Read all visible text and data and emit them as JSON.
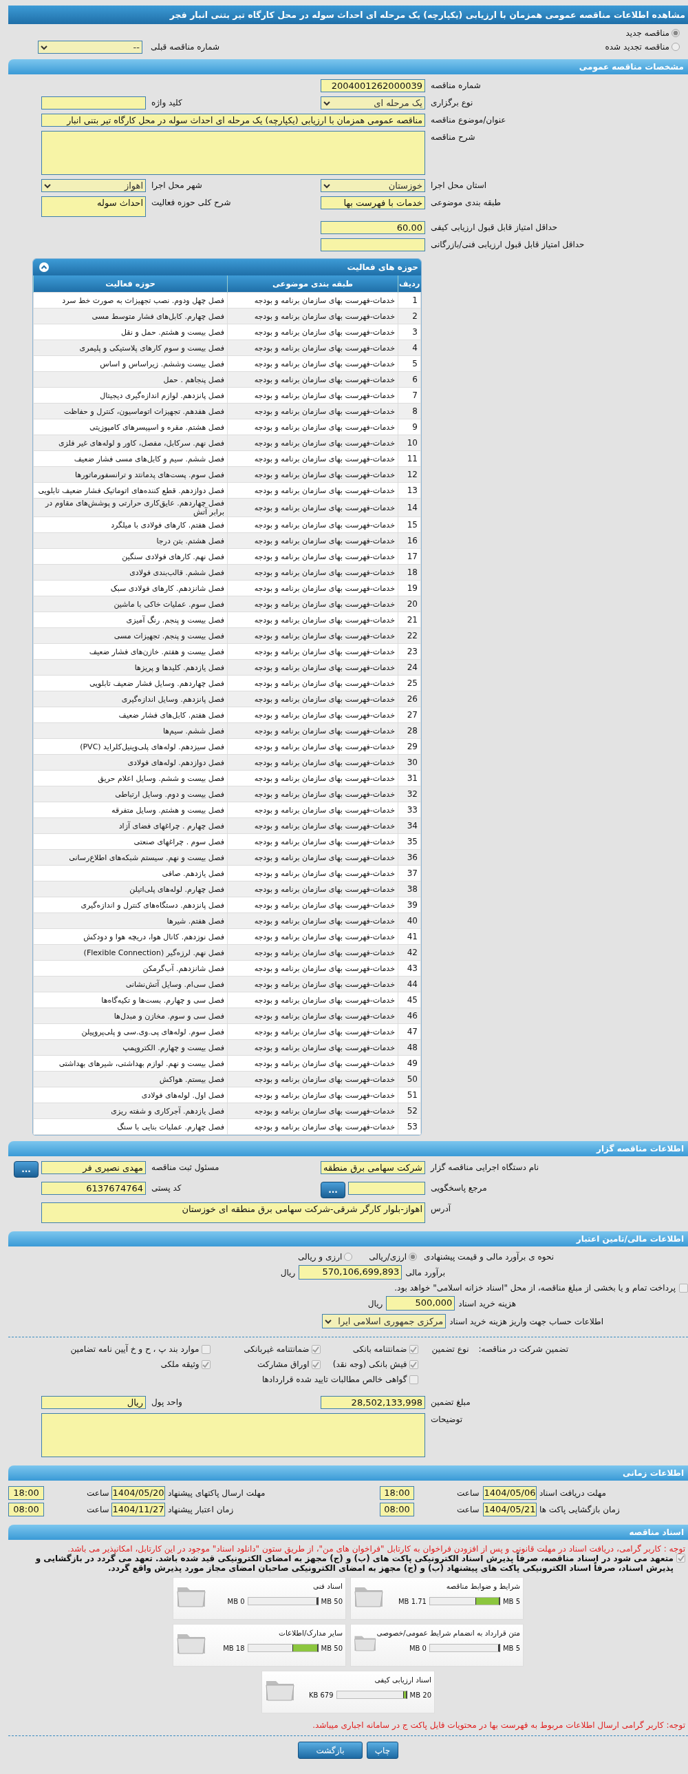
{
  "page_title": "مشاهده اطلاعات مناقصه عمومی همزمان با ارزیابی (یکپارچه) یک مرحله ای احداث سوله در محل کارگاه تیر بتنی انبار فجر",
  "tender_type": [
    {
      "label": "مناقصه جدید",
      "selected": true
    },
    {
      "label": "مناقصه تجدید شده",
      "selected": false
    }
  ],
  "previous_tender": {
    "label": "شماره مناقصه قبلی",
    "value": "--"
  },
  "general": {
    "title": "مشخصات مناقصه عمومی",
    "rows": [
      {
        "fields": [
          {
            "label": "شماره مناقصه",
            "value": "2004001262000039",
            "kind": "text"
          }
        ]
      },
      {
        "fields": [
          {
            "label": "نوع برگزاری",
            "value": "یک مرحله ای",
            "kind": "select"
          },
          {
            "label": "کلید واژه",
            "kind": "text"
          }
        ]
      },
      {
        "fields": [
          {
            "label": "عنوان/موضوع مناقصه",
            "value": "مناقصه عمومی همزمان با ارزیابی (یکپارچه) یک مرحله ای احداث سوله در محل کارگاه تیر بتنی انبار",
            "kind": "long_text"
          }
        ]
      },
      {
        "fields": [
          {
            "label": "شرح مناقصه",
            "kind": "long_textarea"
          }
        ]
      },
      {
        "fields": [
          {
            "label": "استان محل اجرا",
            "value": "خوزستان",
            "kind": "select"
          },
          {
            "label": "شهر محل اجرا",
            "value": "اهواز",
            "kind": "select"
          }
        ]
      },
      {
        "fields": [
          {
            "label": "طبقه بندی موضوعی",
            "value": "خدمات با فهرست بها",
            "kind": "text"
          },
          {
            "label": "شرح کلی حوزه فعالیت",
            "value": "احداث سوله",
            "kind": "textarea"
          }
        ]
      },
      {
        "fields": [
          {
            "label": "حداقل امتیاز قابل قبول ارزیابی کیفی",
            "value": "60.00",
            "kind": "text"
          }
        ]
      },
      {
        "fields": [
          {
            "label": "حداقل امتیاز قابل قبول ارزیابی فنی/بازرگانی",
            "kind": "text"
          }
        ]
      }
    ]
  },
  "activities": {
    "title": "حوزه های فعالیت",
    "columns": [
      "ردیف",
      "طبقه بندی موضوعی",
      "حوزه فعالیت"
    ],
    "rows": [
      [
        "1",
        "خدمات-فهرست بهای سازمان برنامه و بودجه",
        "فصل چهل ودوم. نصب تجهیزات به صورت خط سرد"
      ],
      [
        "2",
        "خدمات-فهرست بهای سازمان برنامه و بودجه",
        "فصل چهارم. کابل‌های فشار متوسط مسی"
      ],
      [
        "3",
        "خدمات-فهرست بهای سازمان برنامه و بودجه",
        "فصل بیست و هشتم. حمل و نقل"
      ],
      [
        "4",
        "خدمات-فهرست بهای سازمان برنامه و بودجه",
        "فصل بیست و سوم کارهای پلاستیکی و پلیمری"
      ],
      [
        "5",
        "خدمات-فهرست بهای سازمان برنامه و بودجه",
        "فصل بیست وششم. زیراساس و اساس"
      ],
      [
        "6",
        "خدمات-فهرست بهای سازمان برنامه و بودجه",
        "فصل پنجاهم . حمل"
      ],
      [
        "7",
        "خدمات-فهرست بهای سازمان برنامه و بودجه",
        "فصل پانزدهم. لوازم اندازه‌گیری دیجیتال"
      ],
      [
        "8",
        "خدمات-فهرست بهای سازمان برنامه و بودجه",
        "فصل هفدهم. تجهیزات اتوماسیون، کنترل و حفاظت"
      ],
      [
        "9",
        "خدمات-فهرست بهای سازمان برنامه و بودجه",
        "فصل هشتم. مقره و اسپیسرهای کامپوزیتی"
      ],
      [
        "10",
        "خدمات-فهرست بهای سازمان برنامه و بودجه",
        "فصل نهم. سرکابل، مفصل، کاور و لوله‌های غیر فلزی"
      ],
      [
        "11",
        "خدمات-فهرست بهای سازمان برنامه و بودجه",
        "فصل ششم. سیم و کابل‌های مسی فشار ضعیف"
      ],
      [
        "12",
        "خدمات-فهرست بهای سازمان برنامه و بودجه",
        "فصل سوم. پست‌های پدمانتد و ترانسفورماتورها"
      ],
      [
        "13",
        "خدمات-فهرست بهای سازمان برنامه و بودجه",
        "فصل دوازدهم. قطع کننده‌های اتوماتیک فشار ضعیف تابلویی"
      ],
      [
        "14",
        "خدمات-فهرست بهای سازمان برنامه و بودجه",
        "فصل چهاردهم. عایق‌کاری حرارتی و پوشش‌های مقاوم در برابر آتش"
      ],
      [
        "15",
        "خدمات-فهرست بهای سازمان برنامه و بودجه",
        "فصل هفتم. کارهای فولادی با میلگرد"
      ],
      [
        "16",
        "خدمات-فهرست بهای سازمان برنامه و بودجه",
        "فصل هشتم. بتن درجا"
      ],
      [
        "17",
        "خدمات-فهرست بهای سازمان برنامه و بودجه",
        "فصل نهم. کارهای فولادی سنگین"
      ],
      [
        "18",
        "خدمات-فهرست بهای سازمان برنامه و بودجه",
        "فصل ششم. قالب‌بندی فولادی"
      ],
      [
        "19",
        "خدمات-فهرست بهای سازمان برنامه و بودجه",
        "فصل شانزدهم. کارهای فولادی سبک"
      ],
      [
        "20",
        "خدمات-فهرست بهای سازمان برنامه و بودجه",
        "فصل سوم. عملیات خاکی با ماشین"
      ],
      [
        "21",
        "خدمات-فهرست بهای سازمان برنامه و بودجه",
        "فصل بیست و پنجم. رنگ آمیزی"
      ],
      [
        "22",
        "خدمات-فهرست بهای سازمان برنامه و بودجه",
        "فصل بیست و پنجم. تجهیزات مسی"
      ],
      [
        "23",
        "خدمات-فهرست بهای سازمان برنامه و بودجه",
        "فصل بیست و هفتم. خازن‌های فشار ضعیف"
      ],
      [
        "24",
        "خدمات-فهرست بهای سازمان برنامه و بودجه",
        "فصل یازدهم. کلیدها و پریزها"
      ],
      [
        "25",
        "خدمات-فهرست بهای سازمان برنامه و بودجه",
        "فصل چهاردهم. وسایل فشار ضعیف تابلویی"
      ],
      [
        "26",
        "خدمات-فهرست بهای سازمان برنامه و بودجه",
        "فصل پانزدهم. وسایل اندازه‌گیری"
      ],
      [
        "27",
        "خدمات-فهرست بهای سازمان برنامه و بودجه",
        "فصل هفتم. کابل‌های فشار ضعیف"
      ],
      [
        "28",
        "خدمات-فهرست بهای سازمان برنامه و بودجه",
        "فصل ششم. سیم‌ها"
      ],
      [
        "29",
        "خدمات-فهرست بهای سازمان برنامه و بودجه",
        "فصل سیزدهم. لوله‌های پلی‌وینیل‌کلراید (PVC)"
      ],
      [
        "30",
        "خدمات-فهرست بهای سازمان برنامه و بودجه",
        "فصل دوازدهم. لوله‌های فولادی"
      ],
      [
        "31",
        "خدمات-فهرست بهای سازمان برنامه و بودجه",
        "فصل بیست و ششم. وسایل اعلام حریق"
      ],
      [
        "32",
        "خدمات-فهرست بهای سازمان برنامه و بودجه",
        "فصل بیست و دوم. وسایل ارتباطی"
      ],
      [
        "33",
        "خدمات-فهرست بهای سازمان برنامه و بودجه",
        "فصل بیست و هشتم. وسایل متفرقه"
      ],
      [
        "34",
        "خدمات-فهرست بهای سازمان برنامه و بودجه",
        "فصل چهارم . چراغهای فضای آزاد"
      ],
      [
        "35",
        "خدمات-فهرست بهای سازمان برنامه و بودجه",
        "فصل سوم . چراغهای صنعتی"
      ],
      [
        "36",
        "خدمات-فهرست بهای سازمان برنامه و بودجه",
        "فصل بیست و نهم. سیستم شبکه‌های اطلاع‌رسانی"
      ],
      [
        "37",
        "خدمات-فهرست بهای سازمان برنامه و بودجه",
        "فصل یازدهم. صافی"
      ],
      [
        "38",
        "خدمات-فهرست بهای سازمان برنامه و بودجه",
        "فصل چهارم. لوله‌های پلی‌اتیلن"
      ],
      [
        "39",
        "خدمات-فهرست بهای سازمان برنامه و بودجه",
        "فصل پانزدهم. دستگاه‌های کنترل و اندازه‌گیری"
      ],
      [
        "40",
        "خدمات-فهرست بهای سازمان برنامه و بودجه",
        "فصل هفتم. شیرها"
      ],
      [
        "41",
        "خدمات-فهرست بهای سازمان برنامه و بودجه",
        "فصل نوزدهم. کانال هوا، دریچه هوا و دودکش"
      ],
      [
        "42",
        "خدمات-فهرست بهای سازمان برنامه و بودجه",
        "فصل نهم. لرزه‌گیر (Flexible Connection)"
      ],
      [
        "43",
        "خدمات-فهرست بهای سازمان برنامه و بودجه",
        "فصل شانزدهم. آب‌گرمکن"
      ],
      [
        "44",
        "خدمات-فهرست بهای سازمان برنامه و بودجه",
        "فصل سی‌ام. وسایل آتش‌نشانی"
      ],
      [
        "45",
        "خدمات-فهرست بهای سازمان برنامه و بودجه",
        "فصل سی و چهارم. بست‌ها و تکیه‌گاه‌ها"
      ],
      [
        "46",
        "خدمات-فهرست بهای سازمان برنامه و بودجه",
        "فصل سی و سوم. مخازن و مبدل‌ها"
      ],
      [
        "47",
        "خدمات-فهرست بهای سازمان برنامه و بودجه",
        "فصل سوم. لوله‌های پی.وی.سی و پلی‌پروپیلن"
      ],
      [
        "48",
        "خدمات-فهرست بهای سازمان برنامه و بودجه",
        "فصل بیست و چهارم. الکتروپمپ"
      ],
      [
        "49",
        "خدمات-فهرست بهای سازمان برنامه و بودجه",
        "فصل بیست و نهم. لوازم بهداشتی، شیرهای بهداشتی"
      ],
      [
        "50",
        "خدمات-فهرست بهای سازمان برنامه و بودجه",
        "فصل بیستم. هواکش"
      ],
      [
        "51",
        "خدمات-فهرست بهای سازمان برنامه و بودجه",
        "فصل اول. لوله‌های فولادی"
      ],
      [
        "52",
        "خدمات-فهرست بهای سازمان برنامه و بودجه",
        "فصل یازدهم. آجرکاری و شفته ریزی"
      ],
      [
        "53",
        "خدمات-فهرست بهای سازمان برنامه و بودجه",
        "فصل چهارم. عملیات بنایی با سنگ"
      ]
    ]
  },
  "organizer": {
    "title": "اطلاعات مناقصه گزار",
    "rows": [
      {
        "fields": [
          {
            "label": "نام دستگاه اجرایی مناقصه گزار",
            "value": "شرکت سهامی برق منطقه",
            "kind": "text"
          },
          {
            "label": "مسئول ثبت مناقصه",
            "value": "مهدی نصیری فر",
            "kind": "text",
            "button": "..."
          }
        ]
      },
      {
        "fields": [
          {
            "label": "مرجع پاسخگویی",
            "kind": "text",
            "button": "..."
          },
          {
            "label": "کد پستی",
            "value": "6137674764",
            "kind": "text"
          }
        ]
      },
      {
        "fields": [
          {
            "label": "آدرس",
            "value": "اهواز-بلوار کارگر شرقی-شرکت سهامی برق منطقه ای خوزستان",
            "kind": "long_textarea"
          }
        ]
      }
    ]
  },
  "financial": {
    "title": "اطلاعات مالی/تامین اعتبار",
    "method": {
      "label": "نحوه ی برآورد مالی و قیمت پیشنهادی",
      "options": [
        {
          "label": "ارزی/ریالی",
          "selected": true
        },
        {
          "label": "ارزی و ریالی",
          "selected": false
        }
      ]
    },
    "estimate": {
      "label": "برآورد مالی",
      "value": "570,106,699,893",
      "unit": "ریال"
    },
    "treasury": {
      "label": "پرداخت تمام و یا بخشی از مبلغ مناقصه، از محل \"اسناد خزانه اسلامی\" خواهد بود.",
      "checked": false
    },
    "doc_fee": {
      "label": "هزینه خرید اسناد",
      "value": "500,000",
      "unit": "ریال"
    },
    "account": {
      "label": "اطلاعات حساب جهت واریز هزینه خرید اسناد",
      "value": "مرکزی جمهوری اسلامی ایرا"
    }
  },
  "guarantee": {
    "heading": "تضمین شرکت در مناقصه:",
    "type_label": "نوع تضمین",
    "options": [
      {
        "label": "ضمانتنامه بانکی",
        "checked": true
      },
      {
        "label": "ضمانتنامه غیربانکی",
        "checked": true
      },
      {
        "label": "موارد بند پ ، ح و خ آیین نامه تضامین",
        "checked": false
      },
      {
        "label": "فیش بانکی (وجه نقد)",
        "checked": true
      },
      {
        "label": "اوراق مشارکت",
        "checked": true
      },
      {
        "label": "وثیقه ملکی",
        "checked": true
      },
      {
        "label": "گواهی خالص مطالبات تایید شده قراردادها",
        "checked": false
      }
    ],
    "rows": [
      {
        "fields": [
          {
            "label": "مبلغ تضمین",
            "value": "28,502,133,998",
            "kind": "text"
          },
          {
            "label": "واحد پول",
            "value": "ریال",
            "kind": "text"
          }
        ]
      },
      {
        "fields": [
          {
            "label": "توضیحات",
            "kind": "long_textarea"
          }
        ]
      }
    ]
  },
  "schedule": {
    "title": "اطلاعات زمانی",
    "rows": [
      [
        {
          "label": "مهلت دریافت اسناد",
          "date": "1404/05/06",
          "time_label": "ساعت",
          "time": "18:00"
        },
        {
          "label": "مهلت ارسال پاکتهای پیشنهاد",
          "date": "1404/05/20",
          "time_label": "ساعت",
          "time": "18:00"
        }
      ],
      [
        {
          "label": "زمان بازگشایی پاکت ها",
          "date": "1404/05/21",
          "time_label": "ساعت",
          "time": "08:00"
        },
        {
          "label": "زمان اعتبار پیشنهاد",
          "date": "1404/11/27",
          "time_label": "ساعت",
          "time": "08:00"
        }
      ]
    ]
  },
  "documents": {
    "title": "اسناد مناقصه",
    "notice": "توجه : کاربر گرامی، دریافت اسناد در مهلت قانونی و پس از افزودن فراخوان به کارتابل \"فراخوان های من\"، از طریق ستون \"دانلود اسناد\" موجود در این کارتابل، امکانپذیر می باشد.",
    "commitment": {
      "text": "متعهد می شود در اسناد مناقصه، صرفاً پذیرش اسناد الکترونیکی پاکت های (ب) و (ج) مجهز به امضای الکترونیکی قید شده باشد. تعهد می گردد در بازگشایی و پذیرش اسناد، صرفاً اسناد الکترونیکی پاکت های پیشنهاد (ب) و (ج) مجهز به امضای الکترونیکی صاحبان امضای مجاز مورد پذیرش واقع گردد.",
      "checked": true
    },
    "files": [
      {
        "name": "شرایط و ضوابط مناقصه",
        "limit": "5 MB",
        "used": "1.71 MB",
        "level": 0.34
      },
      {
        "name": "اسناد فنی",
        "limit": "50 MB",
        "used": "0 MB",
        "level": 0
      },
      {
        "name": "متن قرارداد به انضمام شرایط عمومی/خصوصی",
        "limit": "5 MB",
        "used": "0 MB",
        "level": 0
      },
      {
        "name": "سایر مدارک/اطلاعات",
        "limit": "50 MB",
        "used": "18 MB",
        "level": 0.36
      },
      {
        "name": "اسناد ارزیابی کیفی",
        "limit": "20 MB",
        "used": "679 KB",
        "level": 0.033
      }
    ],
    "footer_note": "توجه: کاربر گرامی ارسال اطلاعات مربوط به فهرست بها در محتویات فایل پاکت ج در سامانه اجباری میباشد."
  },
  "actions": [
    "چاپ",
    "بازگشت"
  ]
}
